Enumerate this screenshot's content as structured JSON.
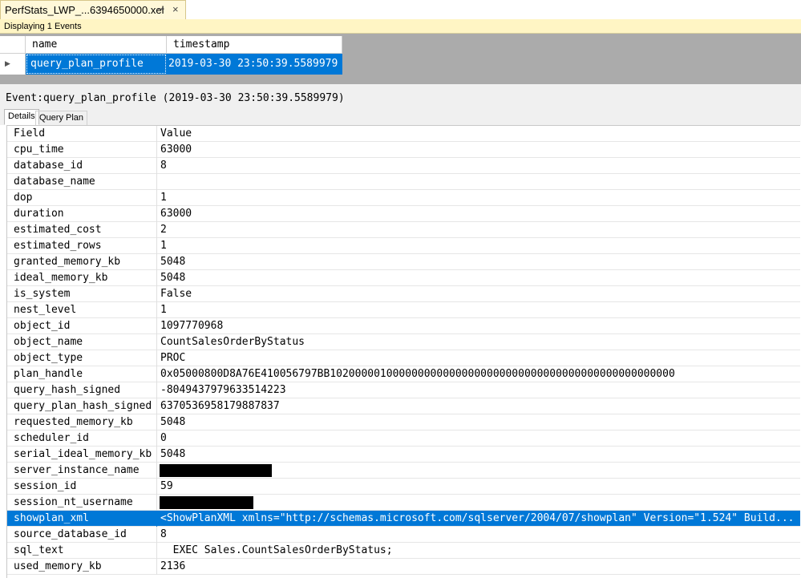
{
  "tab": {
    "title": "PerfStats_LWP_...6394650000.xel",
    "pin_icon": "pin-icon",
    "close_icon": "close-icon"
  },
  "infobar": {
    "text": "Displaying 1 Events"
  },
  "event_grid": {
    "columns": [
      "name",
      "timestamp"
    ],
    "row": {
      "name": "query_plan_profile",
      "timestamp": "2019-03-30 23:50:39.5589979"
    }
  },
  "details": {
    "title": "Event:query_plan_profile (2019-03-30 23:50:39.5589979)",
    "tabs": [
      "Details",
      "Query Plan"
    ],
    "header": {
      "field": "Field",
      "value": "Value"
    },
    "rows": [
      {
        "field": "cpu_time",
        "value": "63000"
      },
      {
        "field": "database_id",
        "value": "8"
      },
      {
        "field": "database_name",
        "value": ""
      },
      {
        "field": "dop",
        "value": "1"
      },
      {
        "field": "duration",
        "value": "63000"
      },
      {
        "field": "estimated_cost",
        "value": "2"
      },
      {
        "field": "estimated_rows",
        "value": "1"
      },
      {
        "field": "granted_memory_kb",
        "value": "5048"
      },
      {
        "field": "ideal_memory_kb",
        "value": "5048"
      },
      {
        "field": "is_system",
        "value": "False"
      },
      {
        "field": "nest_level",
        "value": "1"
      },
      {
        "field": "object_id",
        "value": "1097770968"
      },
      {
        "field": "object_name",
        "value": "CountSalesOrderByStatus"
      },
      {
        "field": "object_type",
        "value": "PROC"
      },
      {
        "field": "plan_handle",
        "value": "0x05000800D8A76E410056797BB1020000010000000000000000000000000000000000000000000000"
      },
      {
        "field": "query_hash_signed",
        "value": "-8049437979633514223"
      },
      {
        "field": "query_plan_hash_signed",
        "value": "6370536958179887837"
      },
      {
        "field": "requested_memory_kb",
        "value": "5048"
      },
      {
        "field": "scheduler_id",
        "value": "0"
      },
      {
        "field": "serial_ideal_memory_kb",
        "value": "5048"
      },
      {
        "field": "server_instance_name",
        "value": "",
        "redacted": true,
        "redact_width": 0.175
      },
      {
        "field": "session_id",
        "value": "59"
      },
      {
        "field": "session_nt_username",
        "value": "",
        "redacted": true,
        "redact_width": 0.146
      },
      {
        "field": "showplan_xml",
        "value": "<ShowPlanXML xmlns=\"http://schemas.microsoft.com/sqlserver/2004/07/showplan\" Version=\"1.524\" Build...",
        "selected": true
      },
      {
        "field": "source_database_id",
        "value": "8"
      },
      {
        "field": "sql_text",
        "value": "  EXEC Sales.CountSalesOrderByStatus;"
      },
      {
        "field": "used_memory_kb",
        "value": "2136"
      }
    ]
  },
  "colors": {
    "selection": "#0078d7",
    "infobar": "#fff5c4",
    "doc_tab": "#fff8d9",
    "grid_bg": "#ababab"
  }
}
